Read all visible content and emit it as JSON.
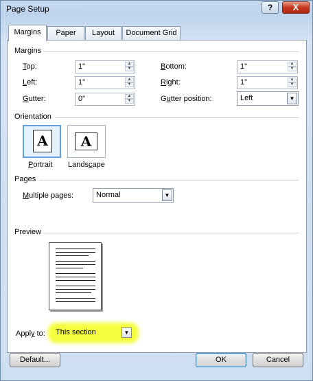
{
  "window": {
    "title": "Page Setup",
    "help_label": "?",
    "close_label": "X"
  },
  "tabs": [
    {
      "label": "Margins"
    },
    {
      "label": "Paper"
    },
    {
      "label": "Layout"
    },
    {
      "label": "Document Grid"
    }
  ],
  "margins": {
    "section": "Margins",
    "top_label": "Top:",
    "top_value": "1\"",
    "bottom_label": "Bottom:",
    "bottom_value": "1\"",
    "left_label": "Left:",
    "left_value": "1\"",
    "right_label": "Right:",
    "right_value": "1\"",
    "gutter_label": "Gutter:",
    "gutter_value": "0\"",
    "gutter_pos_label": "Gutter position:",
    "gutter_pos_value": "Left"
  },
  "orientation": {
    "section": "Orientation",
    "portrait": "Portrait",
    "landscape": "Landscape",
    "glyph": "A",
    "selected": "portrait"
  },
  "pages": {
    "section": "Pages",
    "multiple_label": "Multiple pages:",
    "multiple_value": "Normal"
  },
  "preview": {
    "section": "Preview"
  },
  "apply": {
    "label": "Apply to:",
    "value": "This section",
    "highlight_color": "#f5ff3f"
  },
  "buttons": {
    "default": "Default...",
    "ok": "OK",
    "cancel": "Cancel"
  }
}
